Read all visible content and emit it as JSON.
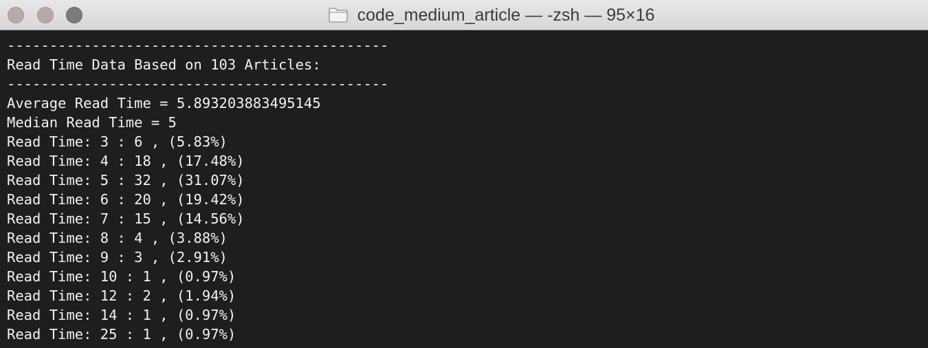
{
  "window": {
    "title": "code_medium_article — -zsh — 95×16",
    "folder_icon": "folder-icon",
    "colors": {
      "titlebar": "#dcd9dc",
      "terminal_bg": "#1e1e1e",
      "terminal_fg": "#f2f2f2",
      "close": "#b6a9a6",
      "minimize": "#b6a9a6",
      "zoom": "#7b7b7b"
    }
  },
  "terminal": {
    "lines": [
      "---------------------------------------------",
      "Read Time Data Based on 103 Articles:",
      "---------------------------------------------",
      "Average Read Time = 5.893203883495145",
      "Median Read Time = 5",
      "Read Time: 3 : 6 , (5.83%)",
      "Read Time: 4 : 18 , (17.48%)",
      "Read Time: 5 : 32 , (31.07%)",
      "Read Time: 6 : 20 , (19.42%)",
      "Read Time: 7 : 15 , (14.56%)",
      "Read Time: 8 : 4 , (3.88%)",
      "Read Time: 9 : 3 , (2.91%)",
      "Read Time: 10 : 1 , (0.97%)",
      "Read Time: 12 : 2 , (1.94%)",
      "Read Time: 14 : 1 , (0.97%)",
      "Read Time: 25 : 1 , (0.97%)"
    ]
  }
}
